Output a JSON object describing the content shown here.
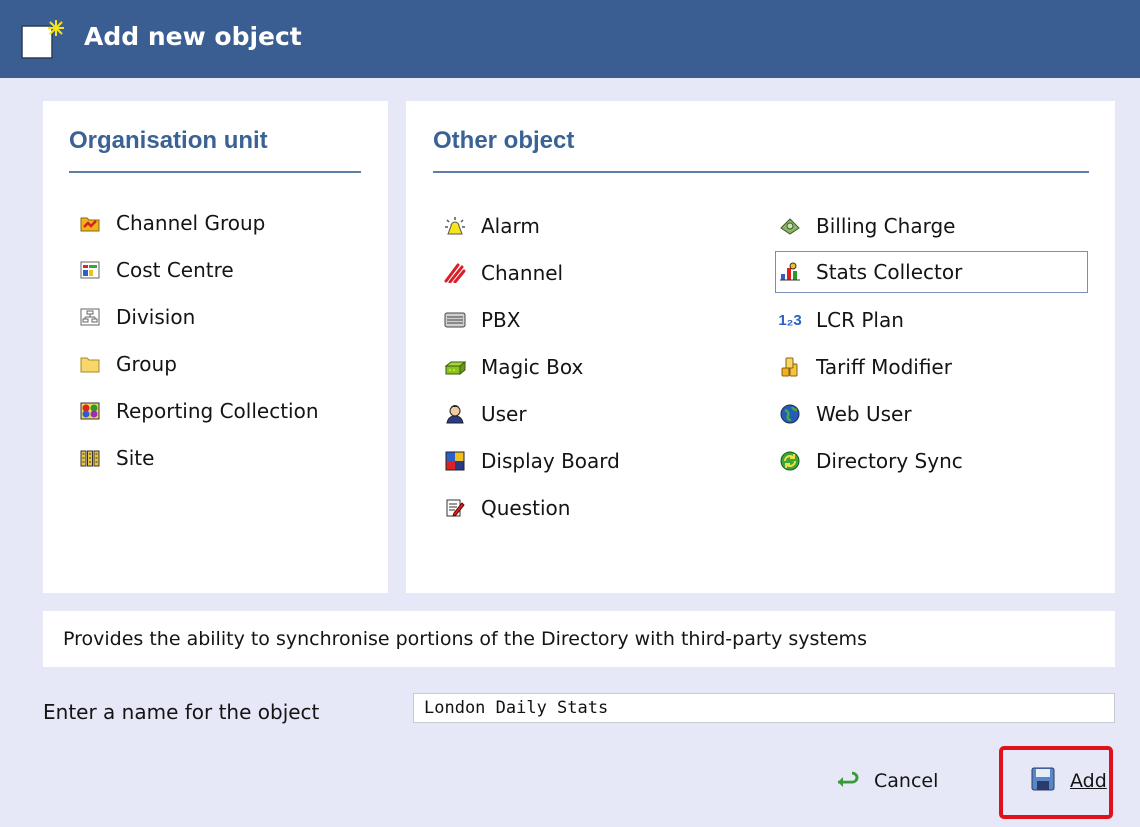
{
  "dialog": {
    "title": "Add new object"
  },
  "organisation_unit": {
    "heading": "Organisation unit",
    "items": [
      {
        "label": "Channel Group",
        "icon": "channel-group-icon"
      },
      {
        "label": "Cost Centre",
        "icon": "cost-centre-icon"
      },
      {
        "label": "Division",
        "icon": "division-icon"
      },
      {
        "label": "Group",
        "icon": "folder-icon"
      },
      {
        "label": "Reporting Collection",
        "icon": "reporting-collection-icon"
      },
      {
        "label": "Site",
        "icon": "site-icon"
      }
    ]
  },
  "other_object": {
    "heading": "Other object",
    "left_items": [
      {
        "label": "Alarm",
        "icon": "alarm-icon"
      },
      {
        "label": "Channel",
        "icon": "channel-icon"
      },
      {
        "label": "PBX",
        "icon": "pbx-icon"
      },
      {
        "label": "Magic Box",
        "icon": "magic-box-icon"
      },
      {
        "label": "User",
        "icon": "user-icon"
      },
      {
        "label": "Display Board",
        "icon": "display-board-icon"
      },
      {
        "label": "Question",
        "icon": "question-icon"
      }
    ],
    "right_items": [
      {
        "label": "Billing Charge",
        "icon": "billing-charge-icon"
      },
      {
        "label": "Stats Collector",
        "icon": "stats-collector-icon",
        "selected": true
      },
      {
        "label": "LCR Plan",
        "icon": "lcr-plan-icon",
        "icon_text": "1₂3"
      },
      {
        "label": "Tariff Modifier",
        "icon": "tariff-modifier-icon"
      },
      {
        "label": "Web User",
        "icon": "web-user-icon"
      },
      {
        "label": "Directory Sync",
        "icon": "directory-sync-icon"
      }
    ]
  },
  "description": "Provides the ability to synchronise portions of the Directory with third-party systems",
  "name_field": {
    "label": "Enter a name for the object",
    "value": "London Daily Stats"
  },
  "actions": {
    "cancel_label": "Cancel",
    "add_label": "Add"
  },
  "colors": {
    "title_bar": "#3b5e92",
    "background": "#e7e8f7",
    "heading": "#3a6294",
    "highlight": "#e0111b"
  }
}
